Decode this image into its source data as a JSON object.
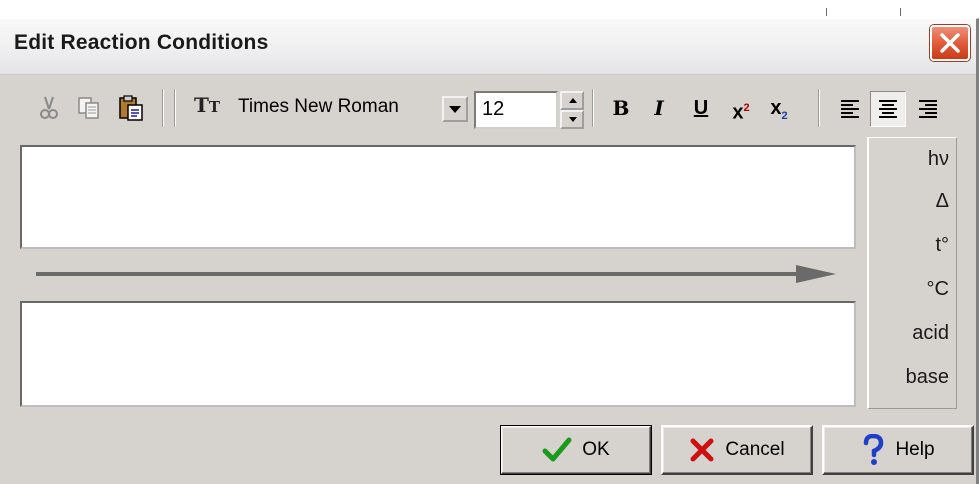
{
  "window": {
    "title": "Edit Reaction Conditions"
  },
  "toolbar": {
    "font_name": "Times New Roman",
    "font_size": "12",
    "bold_label": "B",
    "italic_label": "I",
    "underline_label": "U",
    "superscript_label": "x",
    "superscript_mark": "2",
    "subscript_label": "x",
    "subscript_mark": "2",
    "active_alignment": "center"
  },
  "above_arrow_text": "",
  "below_arrow_text": "",
  "symbols": [
    "hν",
    "Δ",
    "t°",
    "°C",
    "acid",
    "base"
  ],
  "buttons": {
    "ok": "OK",
    "cancel": "Cancel",
    "help": "Help"
  },
  "colors": {
    "close_red": "#d9472b",
    "ok_green": "#1a9a1a",
    "cancel_red": "#d01010",
    "help_blue": "#1e3fc8",
    "dialog_bg": "#d6d3ce"
  }
}
